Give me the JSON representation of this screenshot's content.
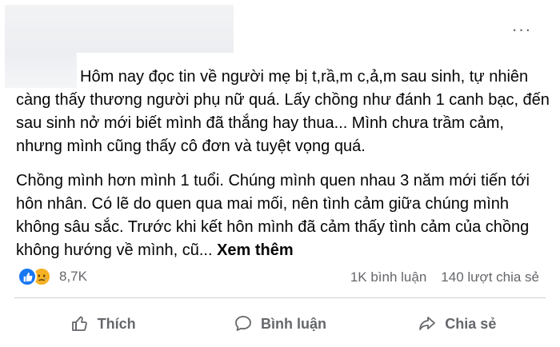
{
  "post": {
    "more_label": "···",
    "paragraphs": [
      "Hôm nay đọc tin về người mẹ bị t,rầ,m c,ả,m sau sinh, tự nhiên càng thấy thương người phụ nữ quá. Lấy chồng như đánh 1 canh bạc, đến sau sinh nở mới biết mình đã thắng hay thua... Mình chưa trầm cảm, nhưng mình cũng thấy cô đơn và tuyệt vọng quá.",
      "Chồng mình hơn mình 1 tuổi. Chúng mình quen nhau 3 năm mới tiến tới hôn nhân. Có lẽ do quen qua mai mối, nên tình cảm giữa chúng mình không sâu sắc. Trước khi kết hôn mình đã cảm thấy tình cảm của chồng không hướng về mình, cũ..."
    ],
    "see_more": "Xem thêm"
  },
  "reactions": {
    "icons": [
      "like-icon",
      "sad-icon"
    ],
    "count": "8,7K"
  },
  "stats": {
    "comments": "1K bình luận",
    "shares": "140 lượt chia sẻ"
  },
  "actions": {
    "like": "Thích",
    "comment": "Bình luận",
    "share": "Chia sẻ"
  },
  "colors": {
    "like_blue": "#1877f2",
    "sad_yellow": "#f7b125",
    "secondary_text": "#65676b",
    "divider": "#ced0d4"
  }
}
